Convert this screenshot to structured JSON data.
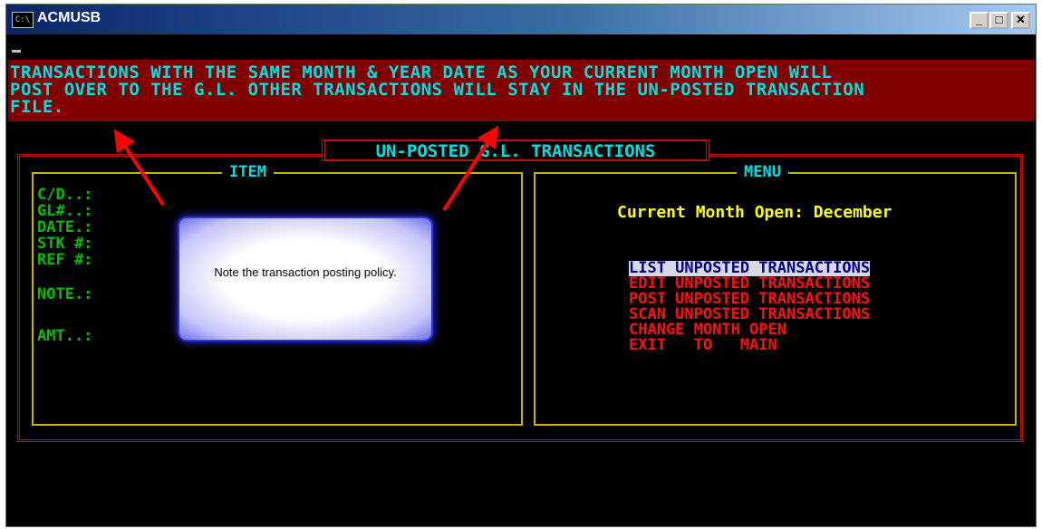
{
  "window": {
    "title": "ACMUSB",
    "icon_name": "console-icon",
    "icon_text": "C:\\",
    "controls": {
      "minimize": "_",
      "maximize": "□",
      "close": "✕"
    }
  },
  "banner": {
    "lines": [
      "TRANSACTIONS WITH THE SAME MONTH & YEAR DATE AS YOUR CURRENT MONTH OPEN WILL",
      "POST OVER TO THE G.L. OTHER TRANSACTIONS WILL STAY IN THE UN-POSTED TRANSACTION",
      "FILE."
    ]
  },
  "screen_title": "UN-POSTED  G.L. TRANSACTIONS",
  "item_panel": {
    "title": "ITEM",
    "fields": [
      "C/D..:",
      "GL#..:",
      "DATE.:",
      "STK #:",
      "REF #:",
      "NOTE.:",
      "AMT..:"
    ]
  },
  "menu_panel": {
    "title": "MENU",
    "current_month_label": "Current Month Open: December",
    "items": [
      "LIST UNPOSTED TRANSACTIONS",
      "EDIT UNPOSTED TRANSACTIONS",
      "POST UNPOSTED TRANSACTIONS",
      "SCAN UNPOSTED TRANSACTIONS",
      "CHANGE MONTH OPEN",
      "EXIT   TO   MAIN"
    ],
    "selected_index": 0
  },
  "callout": {
    "text": "Note the transaction posting policy."
  },
  "colors": {
    "banner_bg": "#800000",
    "banner_text": "#00e0e0",
    "field_text": "#00c000",
    "menu_text": "#ff1010",
    "month_text": "#ffff00",
    "panel_border": "#c8b400",
    "frame_border": "#c01010",
    "arrow": "#ff0000"
  }
}
